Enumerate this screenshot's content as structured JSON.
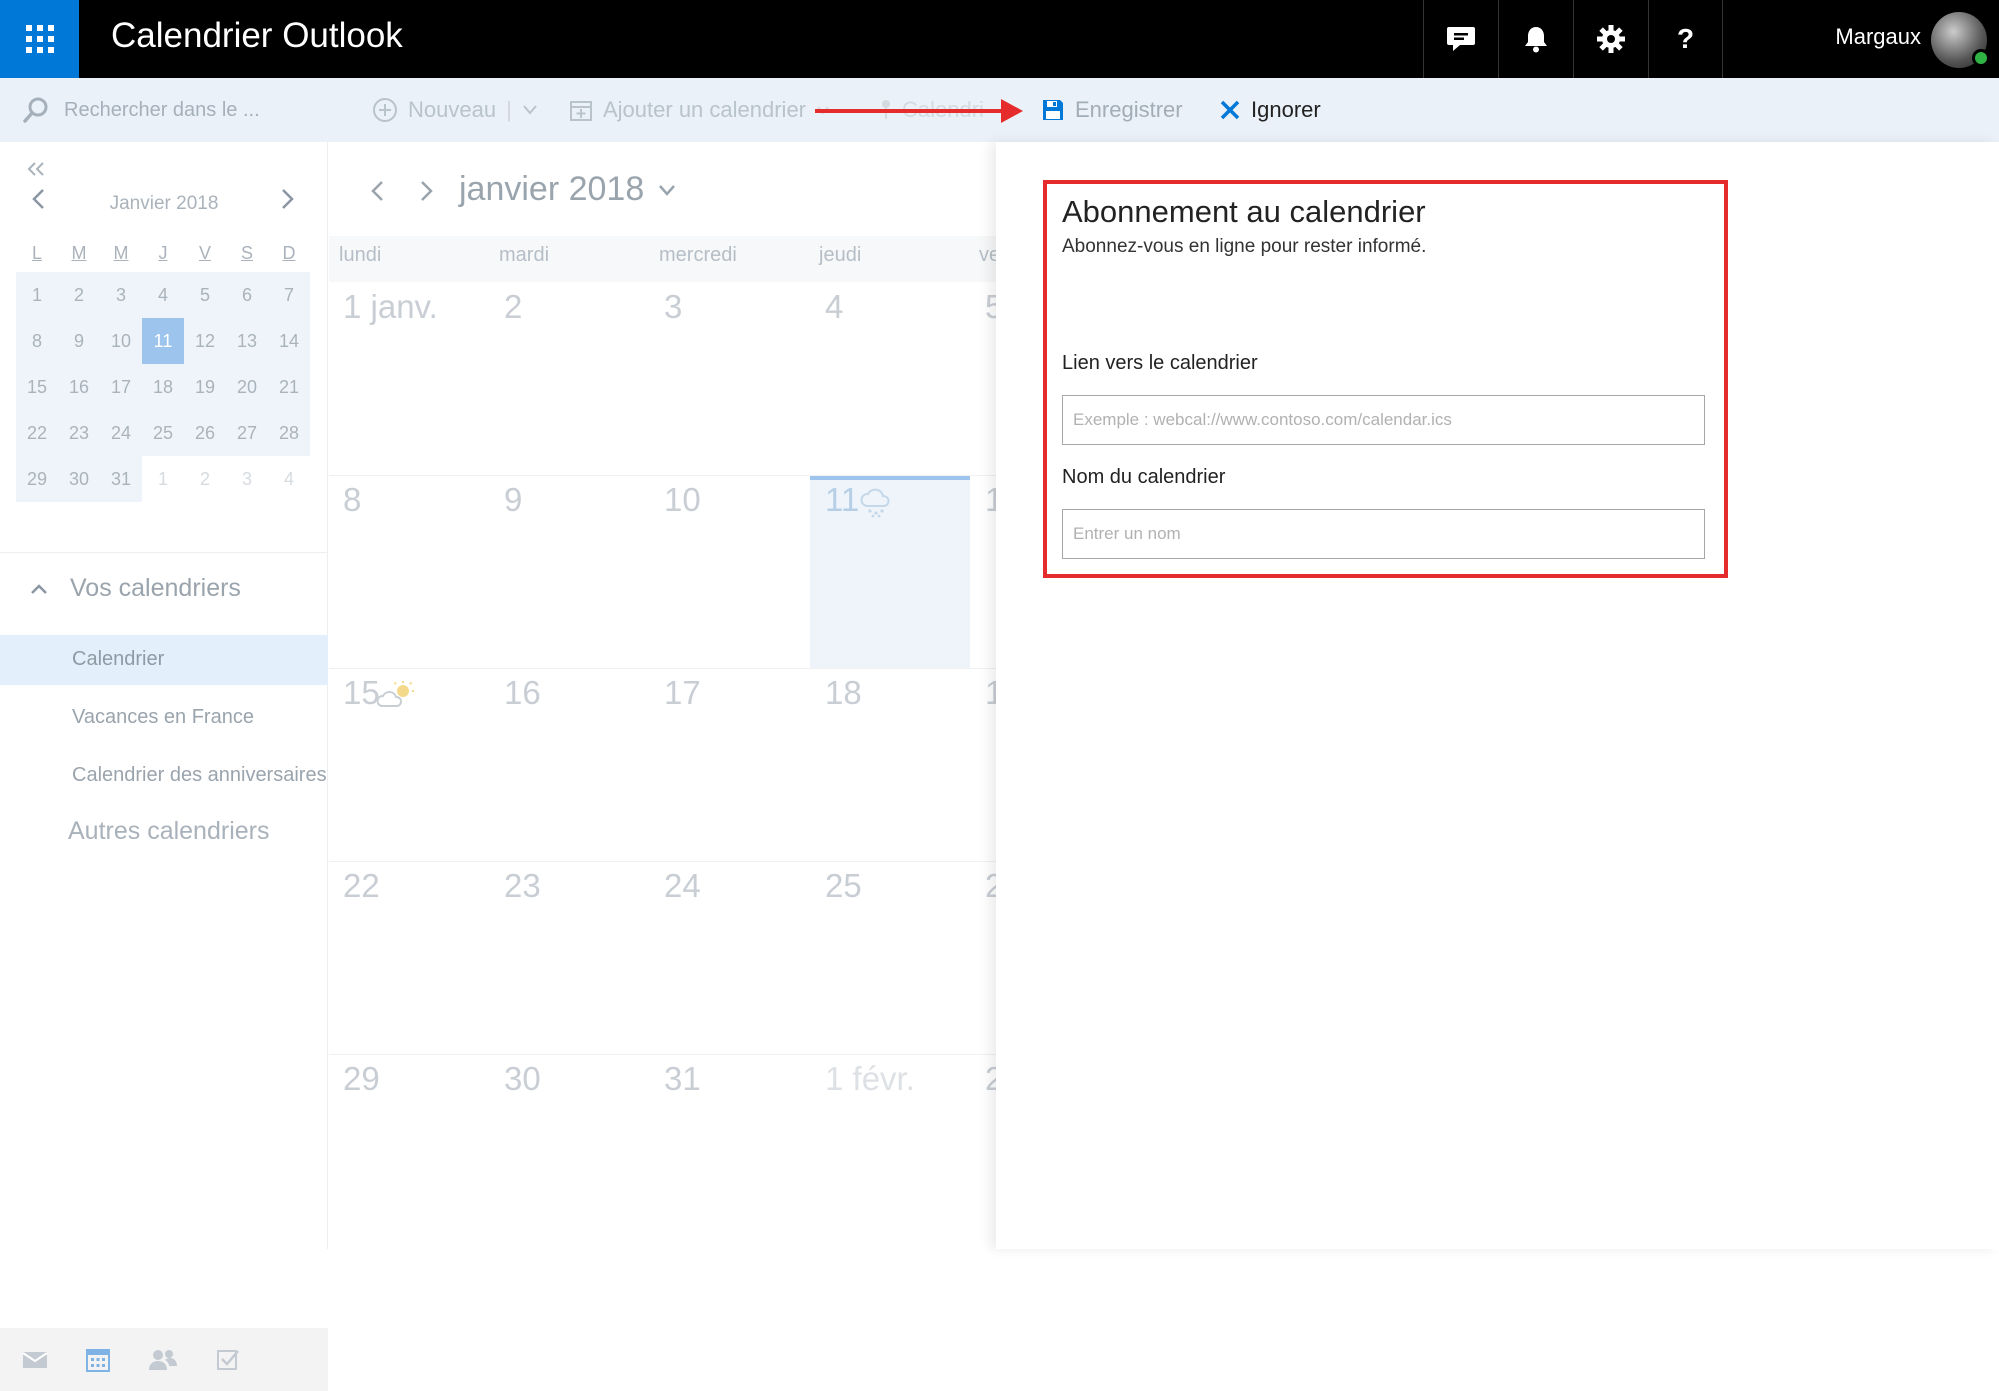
{
  "topbar": {
    "app_title": "Calendrier Outlook",
    "user_name": "Margaux",
    "icons": [
      "chat-icon",
      "bell-icon",
      "gear-icon",
      "help-icon"
    ],
    "help_glyph": "?"
  },
  "commandbar": {
    "search_placeholder": "Rechercher dans le ...",
    "new_label": "Nouveau",
    "add_calendar_label": "Ajouter un calendrier",
    "calendar_label_truncated": "Calendri",
    "save_label": "Enregistrer",
    "discard_label": "Ignorer"
  },
  "mini_calendar": {
    "month_label": "Janvier 2018",
    "weekdays": [
      "L",
      "M",
      "M",
      "J",
      "V",
      "S",
      "D"
    ],
    "weeks": [
      [
        "1",
        "2",
        "3",
        "4",
        "5",
        "6",
        "7"
      ],
      [
        "8",
        "9",
        "10",
        "11",
        "12",
        "13",
        "14"
      ],
      [
        "15",
        "16",
        "17",
        "18",
        "19",
        "20",
        "21"
      ],
      [
        "22",
        "23",
        "24",
        "25",
        "26",
        "27",
        "28"
      ],
      [
        "29",
        "30",
        "31",
        "1",
        "2",
        "3",
        "4"
      ]
    ],
    "selected_day": "11"
  },
  "calendars": {
    "your_calendars_label": "Vos calendriers",
    "items": [
      "Calendrier",
      "Vacances en France",
      "Calendrier des anniversaires"
    ],
    "other_calendars_label": "Autres calendriers"
  },
  "month_view": {
    "title": "janvier 2018",
    "weekdays": [
      "lundi",
      "mardi",
      "mercredi",
      "jeudi",
      "ve"
    ],
    "weeks": [
      [
        "1 janv.",
        "2",
        "3",
        "4",
        "5"
      ],
      [
        "8",
        "9",
        "10",
        "11",
        "1"
      ],
      [
        "15",
        "16",
        "17",
        "18",
        "1"
      ],
      [
        "22",
        "23",
        "24",
        "25",
        "2"
      ],
      [
        "29",
        "30",
        "31",
        "1 févr.",
        "2"
      ]
    ]
  },
  "subscribe_form": {
    "title": "Abonnement au calendrier",
    "subtitle": "Abonnez-vous en ligne pour rester informé.",
    "link_label": "Lien vers le calendrier",
    "link_placeholder": "Exemple : webcal://www.contoso.com/calendar.ics",
    "name_label": "Nom du calendrier",
    "name_placeholder": "Entrer un nom"
  },
  "colors": {
    "accent": "#0078d7",
    "highlight_border": "#e52b2b",
    "selected_calendar_bg": "#e3f0fb"
  }
}
